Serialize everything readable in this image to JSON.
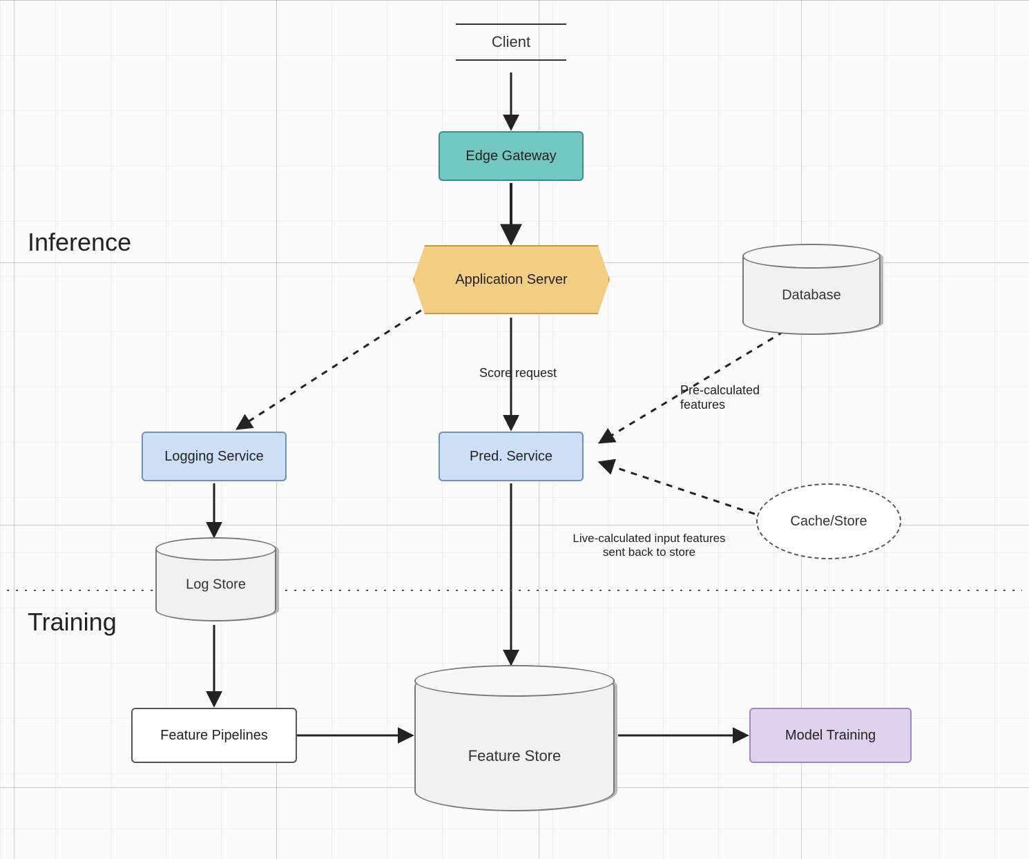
{
  "sections": {
    "inference": "Inference",
    "training": "Training"
  },
  "nodes": {
    "client": {
      "label": "Client"
    },
    "edgeGateway": {
      "label": "Edge Gateway"
    },
    "applicationServer": {
      "label": "Application Server"
    },
    "loggingService": {
      "label": "Logging Service"
    },
    "predService": {
      "label": "Pred. Service"
    },
    "database": {
      "label": "Database"
    },
    "cache": {
      "label": "Cache/Store"
    },
    "logStore": {
      "label": "Log Store"
    },
    "featurePipelines": {
      "label": "Feature Pipelines"
    },
    "featureStore": {
      "label": "Feature Store"
    },
    "modelTraining": {
      "label": "Model Training"
    }
  },
  "edges": {
    "appToPred": "Score request",
    "dbToPred": "Pre-calculated\nfeatures",
    "predToStore": "Live-calculated input features\nsent back to store"
  }
}
